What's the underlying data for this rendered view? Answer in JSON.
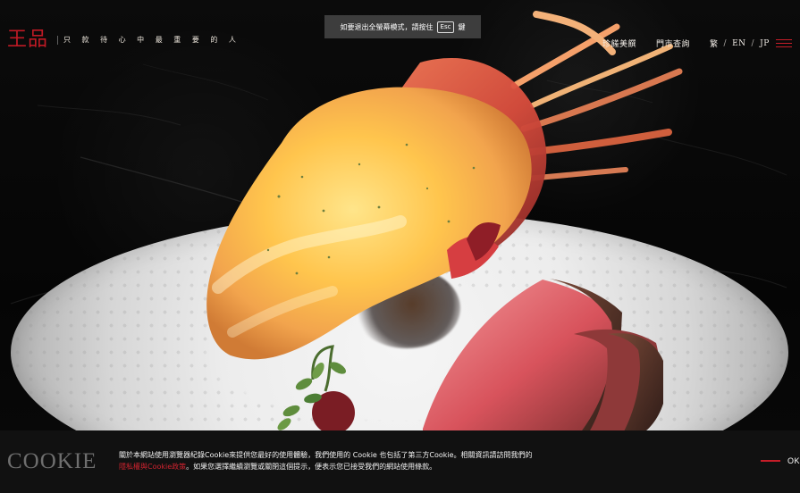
{
  "brand": {
    "logo": "王品",
    "tagline": "只 款 待 心 中 最 重 要 的 人"
  },
  "fullscreen": {
    "message_before": "如要退出全螢幕模式，請按住",
    "key": "Esc",
    "message_after": "鍵"
  },
  "nav": {
    "items": [
      {
        "label": "珍饈美饌"
      },
      {
        "label": "門市查詢"
      }
    ],
    "languages": [
      {
        "label": "繁"
      },
      {
        "label": "EN"
      },
      {
        "label": "JP"
      }
    ],
    "separator": "/"
  },
  "cookie": {
    "title": "COOKIE",
    "text_line1": "關於本網站使用瀏覽器紀錄Cookie來提供您最好的使用體驗，我們使用的 Cookie 也包括了第三方Cookie。相關資訊請訪問我們的",
    "link": "隱私權與Cookie政策",
    "text_line2": "。如果您選擇繼續瀏覽或關閉這個提示，便表示您已接受我們的網站使用條款。",
    "ok": "OK"
  },
  "colors": {
    "accent": "#c61d28",
    "background": "#050505",
    "cookie_bg": "#111111"
  },
  "icons": {
    "menu": "menu-icon",
    "ok_line": "line-icon"
  }
}
